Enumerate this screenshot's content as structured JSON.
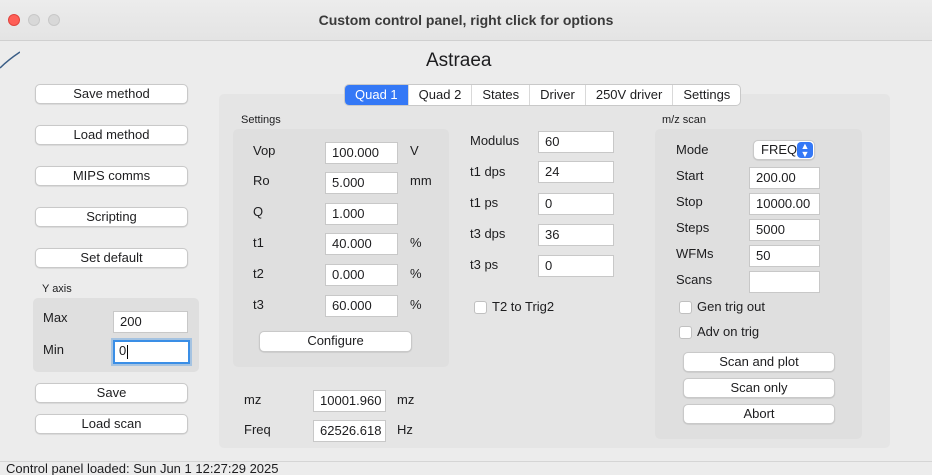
{
  "window": {
    "title": "Custom control panel, right click for options"
  },
  "heading": "Astraea",
  "left_buttons": {
    "save_method": "Save method",
    "load_method": "Load method",
    "mips_comms": "MIPS comms",
    "scripting": "Scripting",
    "set_default": "Set default",
    "save": "Save",
    "load_scan": "Load scan"
  },
  "y_axis": {
    "label": "Y axis",
    "max_label": "Max",
    "max_value": "200",
    "min_label": "Min",
    "min_value": "0"
  },
  "tabs": [
    "Quad 1",
    "Quad 2",
    "States",
    "Driver",
    "250V driver",
    "Settings"
  ],
  "active_tab": "Quad 1",
  "settings": {
    "title": "Settings",
    "rows": [
      {
        "label": "Vop",
        "value": "100.000",
        "unit": "V"
      },
      {
        "label": "Ro",
        "value": "5.000",
        "unit": "mm"
      },
      {
        "label": "Q",
        "value": "1.000",
        "unit": ""
      },
      {
        "label": "t1",
        "value": "40.000",
        "unit": "%"
      },
      {
        "label": "t2",
        "value": "0.000",
        "unit": "%"
      },
      {
        "label": "t3",
        "value": "60.000",
        "unit": "%"
      }
    ],
    "configure_button": "Configure"
  },
  "timing": {
    "rows": [
      {
        "label": "Modulus",
        "value": "60"
      },
      {
        "label": "t1 dps",
        "value": "24"
      },
      {
        "label": "t1 ps",
        "value": "0"
      },
      {
        "label": "t3 dps",
        "value": "36"
      },
      {
        "label": "t3 ps",
        "value": "0"
      }
    ],
    "t2_trig_label": "T2 to Trig2",
    "t2_trig_checked": false
  },
  "readouts": {
    "mz_label": "mz",
    "mz_value": "10001.960",
    "mz_unit": "mz",
    "freq_label": "Freq",
    "freq_value": "62526.618",
    "freq_unit": "Hz"
  },
  "mz_scan": {
    "title": "m/z scan",
    "mode_label": "Mode",
    "mode_value": "FREQ",
    "start_label": "Start",
    "start_value": "200.00",
    "stop_label": "Stop",
    "stop_value": "10000.00",
    "steps_label": "Steps",
    "steps_value": "5000",
    "wfms_label": "WFMs",
    "wfms_value": "50",
    "scans_label": "Scans",
    "scans_value": "",
    "gen_trig_label": "Gen trig out",
    "gen_trig_checked": false,
    "adv_trig_label": "Adv on trig",
    "adv_trig_checked": false,
    "scan_and_plot": "Scan and plot",
    "scan_only": "Scan only",
    "abort": "Abort"
  },
  "status": "Control panel loaded: Sun Jun 1 12:27:29 2025",
  "colors": {
    "accent": "#3478f6",
    "close": "#ff5f57",
    "focus": "#3a8ee6"
  }
}
